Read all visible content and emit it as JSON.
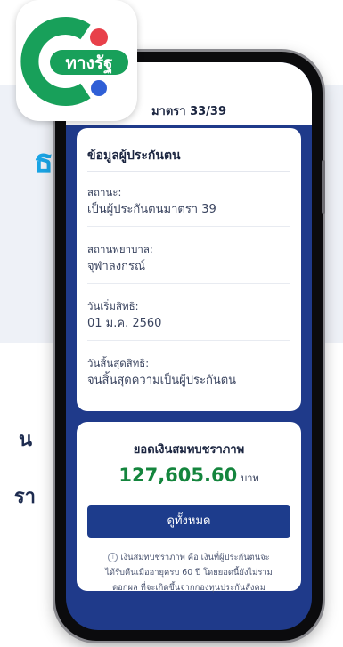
{
  "app_icon": {
    "brand_text": "ทางรัฐ"
  },
  "background": {
    "left_glyph": "ธ",
    "left_text_line1": "น",
    "left_text_line2": "รา"
  },
  "screen": {
    "title": "มาตรา 33/39",
    "insurance_card": {
      "title": "ข้อมูลผู้ประกันตน",
      "fields": [
        {
          "label": "สถานะ:",
          "value": "เป็นผู้ประกันตนมาตรา 39"
        },
        {
          "label": "สถานพยาบาล:",
          "value": "จุฬาลงกรณ์"
        },
        {
          "label": "วันเริ่มสิทธิ:",
          "value": "01 ม.ค. 2560"
        },
        {
          "label": "วันสิ้นสุดสิทธิ:",
          "value": "จนสิ้นสุดความเป็นผู้ประกันตน"
        }
      ]
    },
    "pension_card": {
      "title": "ยอดเงินสมทบชราภาพ",
      "amount": "127,605.60",
      "unit": "บาท",
      "view_all_label": "ดูทั้งหมด",
      "note_line1": "เงินสมทบชราภาพ คือ เงินที่ผู้ประกันตนจะ",
      "note_line2": "ได้รับคืนเมื่ออายุครบ 60 ปี โดยยอดนี้ยังไม่รวม",
      "note_line3": "ดอกผล ที่จะเกิดขึ้นจากกองทุนประกันสังคม"
    }
  },
  "colors": {
    "primary_blue": "#1d3c8c",
    "amount_green": "#14853d",
    "icon_green": "#18a05a",
    "icon_red": "#e8404a",
    "icon_blue": "#2f5fd6"
  }
}
